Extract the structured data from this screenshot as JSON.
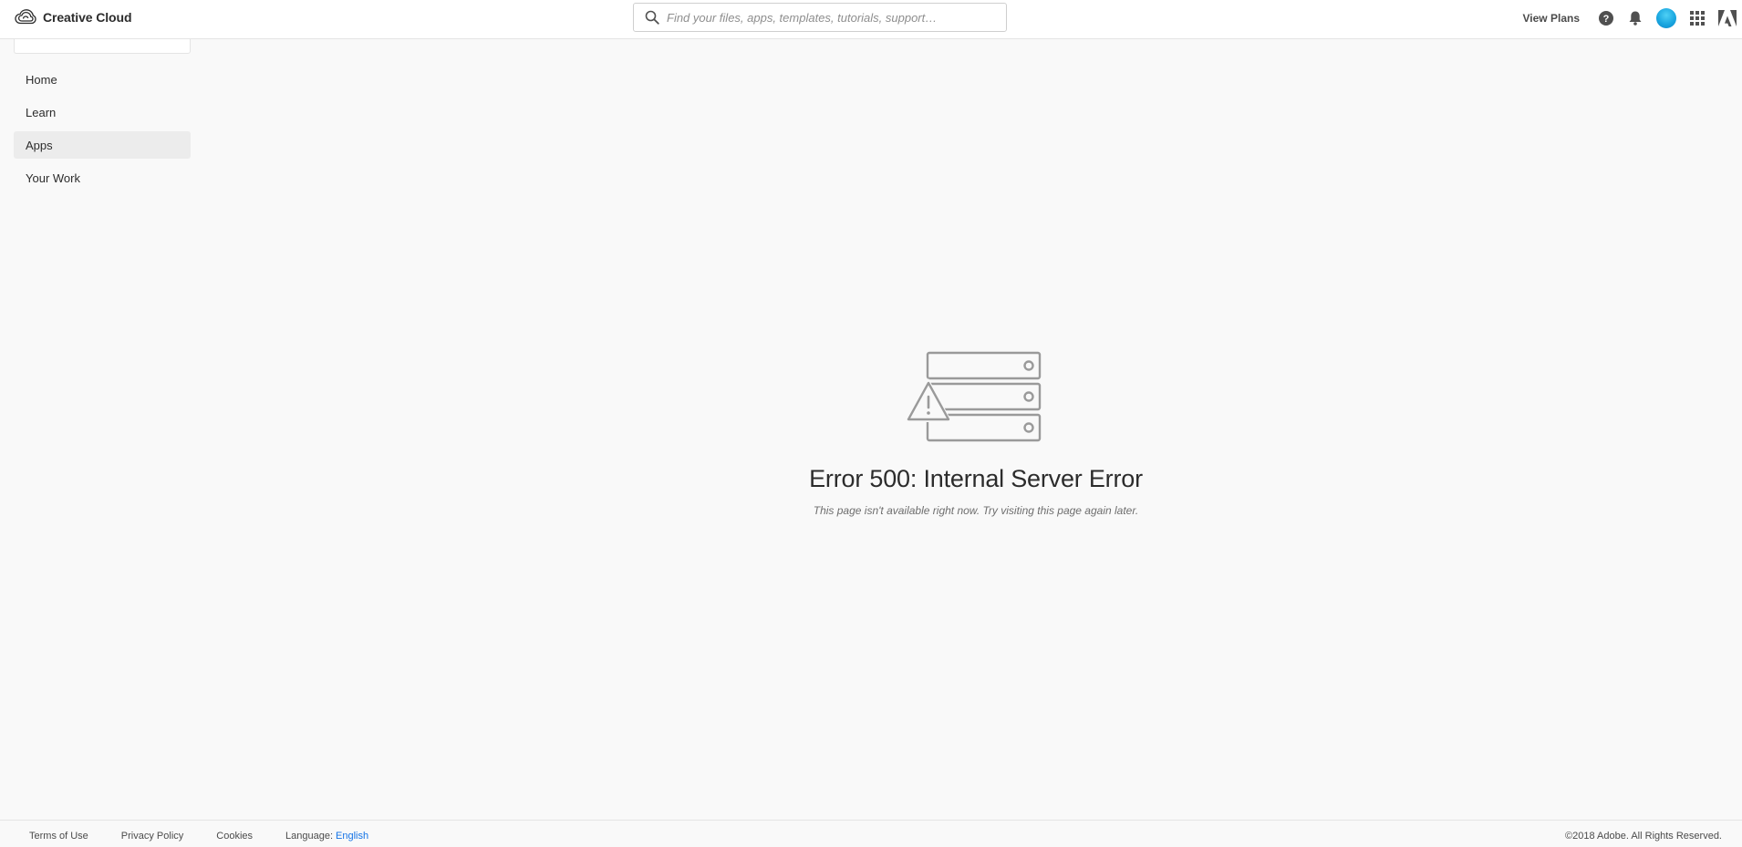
{
  "header": {
    "brand": "Creative Cloud",
    "search_placeholder": "Find your files, apps, templates, tutorials, support…",
    "view_plans": "View Plans",
    "icons": [
      "help-icon",
      "bell-icon",
      "avatar",
      "app-grid-icon",
      "adobe-logo-icon"
    ],
    "avatar_color": "#1aa7e0"
  },
  "sidebar": {
    "items": [
      {
        "label": "Home",
        "active": false
      },
      {
        "label": "Learn",
        "active": false
      },
      {
        "label": "Apps",
        "active": true
      },
      {
        "label": "Your Work",
        "active": false
      }
    ]
  },
  "error": {
    "illustration": "server-warning-icon",
    "title": "Error 500: Internal Server Error",
    "message": "This page isn't available right now. Try visiting this page again later."
  },
  "footer": {
    "links": [
      "Terms of Use",
      "Privacy Policy",
      "Cookies"
    ],
    "language_label": "Language:",
    "language_value": "English",
    "copyright": "©2018 Adobe. All Rights Reserved."
  },
  "colors": {
    "accent": "#1473e6",
    "background": "#f9f9f9",
    "active_nav": "#ececec"
  }
}
